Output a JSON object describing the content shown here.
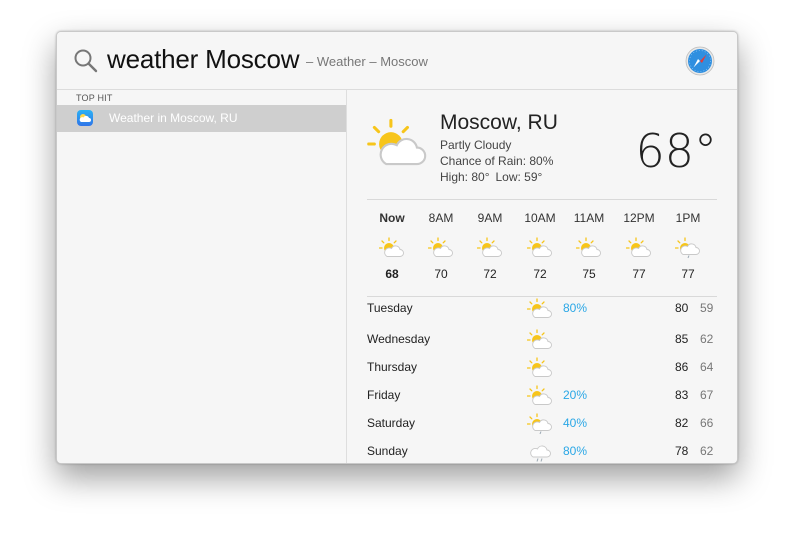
{
  "search": {
    "query": "weather Moscow",
    "hint": "– Weather – Moscow"
  },
  "sidebar": {
    "section_header": "TOP HIT",
    "top_hit": {
      "label": "Weather in Moscow, RU",
      "icon": "weather-app-icon"
    }
  },
  "annotation": {
    "arrow_color": "#e02020",
    "icon": "up-arrow-icon"
  },
  "weather": {
    "city": "Moscow, RU",
    "condition": "Partly Cloudy",
    "rain": "Chance of Rain: 80%",
    "high": "High: 80°",
    "low": "Low: 59°",
    "temp": "68°",
    "icon": "partly-cloudy-icon",
    "hourly": [
      {
        "label": "Now",
        "temp": "68",
        "icon": "partly-cloudy-icon"
      },
      {
        "label": "8AM",
        "temp": "70",
        "icon": "partly-cloudy-icon"
      },
      {
        "label": "9AM",
        "temp": "72",
        "icon": "partly-cloudy-icon"
      },
      {
        "label": "10AM",
        "temp": "72",
        "icon": "partly-cloudy-icon"
      },
      {
        "label": "11AM",
        "temp": "75",
        "icon": "partly-cloudy-icon"
      },
      {
        "label": "12PM",
        "temp": "77",
        "icon": "partly-cloudy-icon"
      },
      {
        "label": "1PM",
        "temp": "77",
        "icon": "partly-cloudy-rain-icon"
      }
    ],
    "daily": [
      {
        "day": "Tuesday",
        "pct": "80%",
        "hi": "80",
        "lo": "59",
        "icon": "partly-cloudy-icon"
      },
      {
        "day": "Wednesday",
        "pct": "",
        "hi": "85",
        "lo": "62",
        "icon": "partly-cloudy-icon"
      },
      {
        "day": "Thursday",
        "pct": "",
        "hi": "86",
        "lo": "64",
        "icon": "partly-cloudy-icon"
      },
      {
        "day": "Friday",
        "pct": "20%",
        "hi": "83",
        "lo": "67",
        "icon": "partly-cloudy-icon"
      },
      {
        "day": "Saturday",
        "pct": "40%",
        "hi": "82",
        "lo": "66",
        "icon": "partly-cloudy-rain-icon"
      },
      {
        "day": "Sunday",
        "pct": "80%",
        "hi": "78",
        "lo": "62",
        "icon": "rain-icon"
      }
    ]
  },
  "colors": {
    "accent_blue": "#2aa7e6",
    "selection": "#cfcfcf",
    "sun": "#f7c51a"
  }
}
